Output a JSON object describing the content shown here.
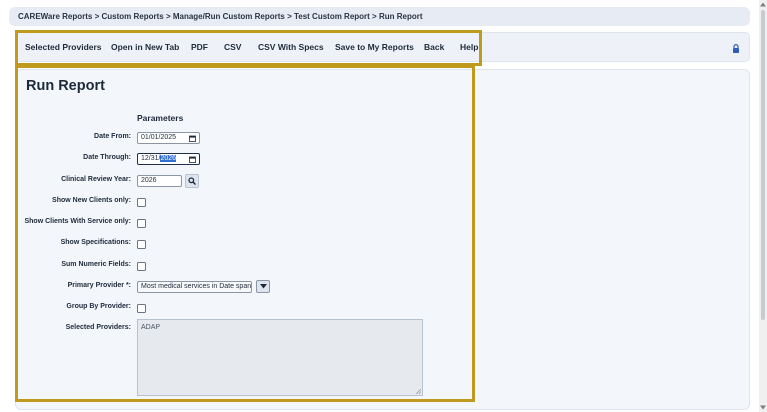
{
  "breadcrumb": {
    "text": "CAREWare Reports > Custom Reports > Manage/Run Custom Reports > Test Custom Report > Run Report"
  },
  "toolbar": {
    "items": [
      {
        "label": "Selected Providers"
      },
      {
        "label": "Open in New Tab"
      },
      {
        "label": "PDF"
      },
      {
        "label": "CSV"
      },
      {
        "label": "CSV With Specs"
      },
      {
        "label": "Save to My Reports"
      },
      {
        "label": "Back"
      },
      {
        "label": "Help"
      }
    ],
    "lock_icon": "lock-icon"
  },
  "page": {
    "title": "Run Report"
  },
  "params": {
    "heading": "Parameters",
    "date_from": {
      "label": "Date From:",
      "value": "01/01/2025"
    },
    "date_through": {
      "label": "Date Through:",
      "value_part": "12/31/",
      "value_selected": "2026"
    },
    "review_year": {
      "label": "Clinical Review Year:",
      "value": "2026"
    },
    "new_clients": {
      "label": "Show New Clients only:"
    },
    "clients_with_service": {
      "label": "Show Clients With Service only:"
    },
    "show_specs": {
      "label": "Show Specifications:"
    },
    "sum_numeric": {
      "label": "Sum Numeric Fields:"
    },
    "primary_provider": {
      "label": "Primary Provider *:",
      "value": "Most medical services in Date span"
    },
    "group_by_provider": {
      "label": "Group By Provider:"
    },
    "selected_providers": {
      "label": "Selected Providers:",
      "value": "ADAP"
    }
  },
  "colors": {
    "highlight": "#c09a1c",
    "accent": "#2f6fd6",
    "text": "#1e2a3a"
  }
}
